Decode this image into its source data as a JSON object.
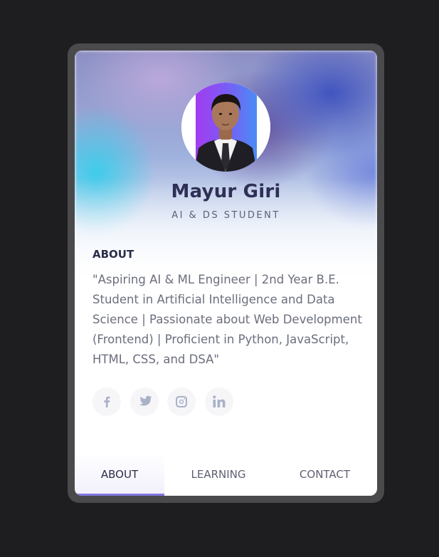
{
  "profile": {
    "name": "Mayur Giri",
    "role": "AI & DS STUDENT"
  },
  "about": {
    "title": "ABOUT",
    "text": "\"Aspiring AI & ML Engineer | 2nd Year B.E. Student in Artificial Intelligence and Data Science | Passionate about Web Development (Frontend) | Proficient in Python, JavaScript, HTML, CSS, and DSA\""
  },
  "socials": [
    {
      "icon": "facebook-icon"
    },
    {
      "icon": "twitter-icon"
    },
    {
      "icon": "instagram-icon"
    },
    {
      "icon": "linkedin-icon"
    }
  ],
  "tabs": [
    {
      "label": "ABOUT",
      "active": true
    },
    {
      "label": "LEARNING",
      "active": false
    },
    {
      "label": "CONTACT",
      "active": false
    }
  ],
  "colors": {
    "accent": "#8179e0",
    "heading": "#2a2d4a",
    "body_text": "#6b6e7e",
    "social_icon": "#aab2c8"
  }
}
